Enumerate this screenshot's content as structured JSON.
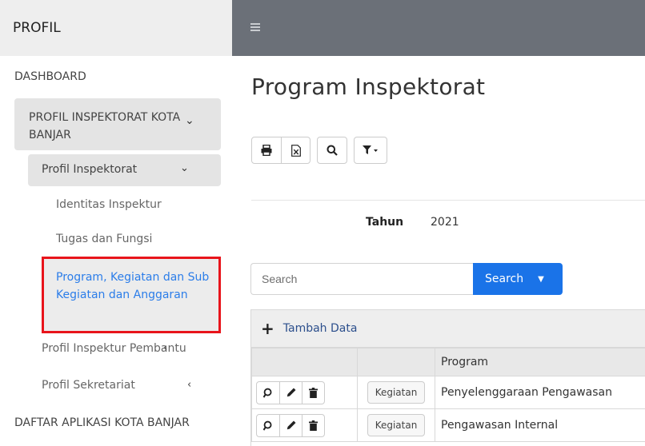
{
  "sidebar": {
    "brand": "PROFIL",
    "dashboard": "DASHBOARD",
    "group_label": "PROFIL INSPEKTORAT KOTA BANJAR",
    "sub_label": "Profil Inspektorat",
    "leaf_1": "Identitas Inspektur",
    "leaf_2": "Tugas dan Fungsi",
    "active_leaf": "Program, Kegiatan dan Sub Kegiatan dan Anggaran",
    "item_pembantu": "Profil Inspektur Pembantu",
    "item_sekretariat": "Profil Sekretariat",
    "bottom_item": "DAFTAR APLIKASI KOTA BANJAR"
  },
  "main": {
    "title": "Program Inspektorat",
    "filter": {
      "label": "Tahun",
      "value": "2021"
    },
    "search": {
      "placeholder": "Search",
      "button_label": "Search"
    },
    "add_label": "Tambah Data",
    "table": {
      "headers": [
        "",
        "",
        "Program"
      ],
      "rows": [
        {
          "button": "Kegiatan",
          "program": "Penyelenggaraan Pengawasan"
        },
        {
          "button": "Kegiatan",
          "program": "Pengawasan Internal"
        }
      ]
    }
  },
  "colors": {
    "topbar": "#6b7078",
    "accent": "#1a73e8",
    "highlight_border": "#e8141b",
    "active_link": "#2b7de9"
  }
}
